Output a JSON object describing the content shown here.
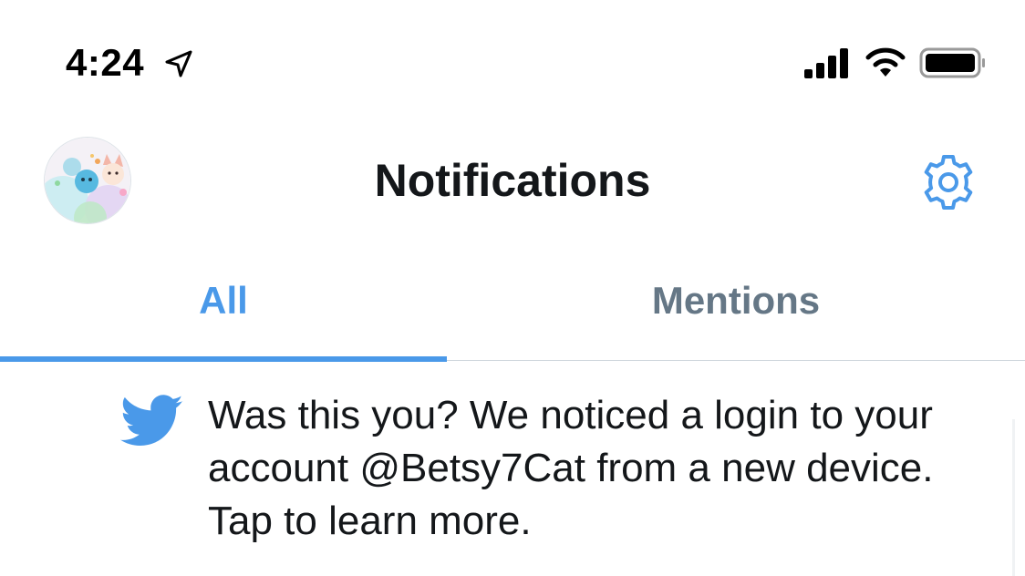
{
  "status_bar": {
    "time": "4:24",
    "icons": [
      "location-arrow-icon",
      "cellular-signal-icon",
      "wifi-icon",
      "battery-icon"
    ]
  },
  "header": {
    "title": "Notifications",
    "avatar": "profile-avatar",
    "settings_icon": "gear-icon"
  },
  "tabs": [
    {
      "label": "All",
      "active": true
    },
    {
      "label": "Mentions",
      "active": false
    }
  ],
  "notifications": [
    {
      "icon": "twitter-bird-icon",
      "text": "Was this you? We noticed a login to your account @Betsy7Cat from a new device. Tap to learn more."
    }
  ],
  "colors": {
    "accent": "#4a99e9",
    "text_primary": "#14171a",
    "text_secondary": "#657786",
    "divider": "#cfd6dc"
  }
}
